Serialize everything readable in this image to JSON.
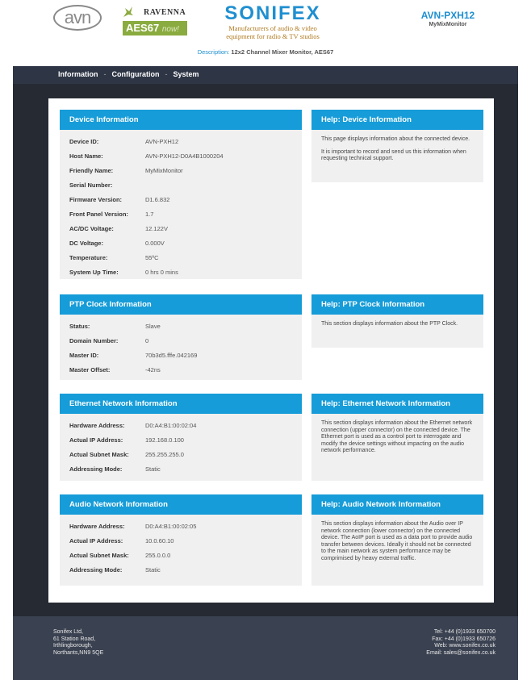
{
  "header": {
    "avn_logo": "avn",
    "ravenna_label": "RAVENNA",
    "aes67_label": "AES67",
    "aes67_suffix": "now!",
    "brand": "SONIFEX",
    "tagline_1": "Manufacturers of audio & video",
    "tagline_2": "equipment for radio & TV studios",
    "model": "AVN-PXH12",
    "device_name": "MyMixMonitor",
    "description_label": "Description:",
    "description_value": "12x2 Channel Mixer Monitor, AES67"
  },
  "nav": {
    "items": [
      "Information",
      "Configuration",
      "System"
    ],
    "separator": "-"
  },
  "sections": {
    "device": {
      "title": "Device Information",
      "rows": [
        {
          "k": "Device ID:",
          "v": "AVN-PXH12"
        },
        {
          "k": "Host Name:",
          "v": "AVN-PXH12-D0A4B1000204"
        },
        {
          "k": "Friendly Name:",
          "v": "MyMixMonitor"
        },
        {
          "k": "Serial Number:",
          "v": ""
        },
        {
          "k": "Firmware Version:",
          "v": "D1.6.832"
        },
        {
          "k": "Front Panel Version:",
          "v": "1.7"
        },
        {
          "k": "AC/DC Voltage:",
          "v": "12.122V"
        },
        {
          "k": "DC Voltage:",
          "v": "0.000V"
        },
        {
          "k": "Temperature:",
          "v": "55ºC"
        },
        {
          "k": "System Up Time:",
          "v": "0 hrs 0 mins"
        }
      ]
    },
    "ptp": {
      "title": "PTP Clock Information",
      "rows": [
        {
          "k": "Status:",
          "v": "Slave"
        },
        {
          "k": "Domain Number:",
          "v": "0"
        },
        {
          "k": "Master ID:",
          "v": "70b3d5.fffe.042169"
        },
        {
          "k": "Master Offset:",
          "v": "-42ns"
        }
      ]
    },
    "ethernet": {
      "title": "Ethernet Network Information",
      "rows": [
        {
          "k": "Hardware Address:",
          "v": "D0:A4:B1:00:02:04"
        },
        {
          "k": "Actual IP Address:",
          "v": "192.168.0.100"
        },
        {
          "k": "Actual Subnet Mask:",
          "v": "255.255.255.0"
        },
        {
          "k": "Addressing Mode:",
          "v": "Static"
        }
      ]
    },
    "audio": {
      "title": "Audio Network Information",
      "rows": [
        {
          "k": "Hardware Address:",
          "v": "D0:A4:B1:00:02:05"
        },
        {
          "k": "Actual IP Address:",
          "v": "10.0.60.10"
        },
        {
          "k": "Actual Subnet Mask:",
          "v": "255.0.0.0"
        },
        {
          "k": "Addressing Mode:",
          "v": "Static"
        }
      ]
    }
  },
  "help": {
    "device": {
      "title": "Help: Device Information",
      "p1": "This page displays information about the connected device.",
      "p2": "It is important to record and send us this information when requesting technical support."
    },
    "ptp": {
      "title": "Help: PTP Clock Information",
      "p1": "This section displays information about the PTP Clock."
    },
    "ethernet": {
      "title": "Help: Ethernet Network Information",
      "p1": "This section displays information about the Ethernet network connection (upper connector) on the connected device. The Ethernet port is used as a control port to interrogate and modify the device settings without impacting on the audio network performance."
    },
    "audio": {
      "title": "Help: Audio Network Information",
      "p1": "This section displays information about the Audio over IP network connection (lower connector) on the connected device. The AoIP port is used as a data port to provide audio transfer between devices. Ideally it should not be connected to the main network as system performance may be comprimised by heavy external traffic."
    }
  },
  "footer": {
    "address": [
      "Sonifex Ltd,",
      "61 Station Road,",
      "Irthlingborough,",
      "Northants,NN9 5QE"
    ],
    "contact": [
      "Tel: +44 (0)1933 650700",
      "Fax: +44 (0)1933 650726",
      "Web: www.sonifex.co.uk",
      "Email: sales@sonifex.co.uk"
    ]
  },
  "colors": {
    "accent": "#169cd8",
    "nav": "#2e3545",
    "dark_bg": "#252a33",
    "footer": "#3a4150"
  }
}
